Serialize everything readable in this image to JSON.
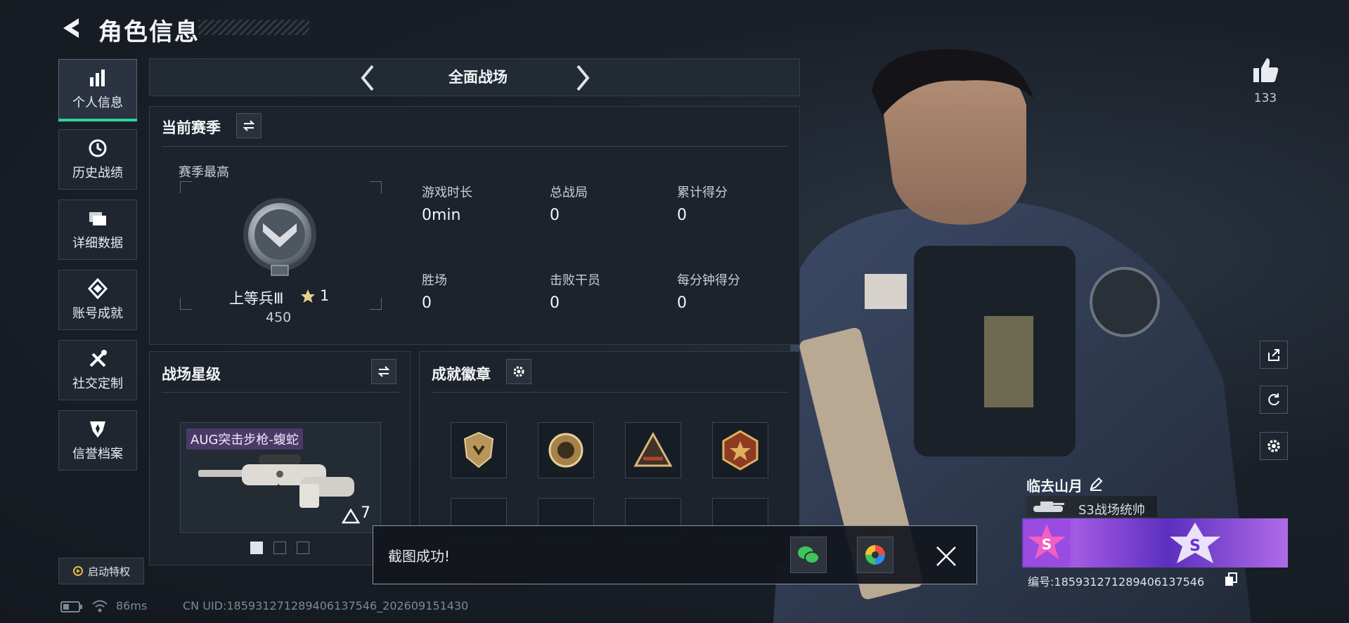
{
  "header": {
    "title": "角色信息"
  },
  "sidebar": {
    "items": [
      {
        "label": "个人信息",
        "icon": "bar-chart-icon"
      },
      {
        "label": "历史战绩",
        "icon": "history-icon"
      },
      {
        "label": "详细数据",
        "icon": "folder-icon"
      },
      {
        "label": "账号成就",
        "icon": "achievement-icon"
      },
      {
        "label": "社交定制",
        "icon": "tools-icon"
      },
      {
        "label": "信誉档案",
        "icon": "shield-icon"
      }
    ],
    "privilege_label": "启动特权"
  },
  "mode": {
    "label": "全面战场"
  },
  "season": {
    "title": "当前赛季",
    "best_label": "赛季最高",
    "rank_name": "上等兵Ⅲ",
    "rank_stars": "1",
    "rank_score": "450",
    "stats": [
      {
        "label": "游戏时长",
        "value": "0min"
      },
      {
        "label": "总战局",
        "value": "0"
      },
      {
        "label": "累计得分",
        "value": "0"
      },
      {
        "label": "胜场",
        "value": "0"
      },
      {
        "label": "击败干员",
        "value": "0"
      },
      {
        "label": "每分钟得分",
        "value": "0"
      }
    ]
  },
  "star_level": {
    "title": "战场星级",
    "weapon_name": "AUG突击步枪-蝮蛇",
    "weapon_level": "7"
  },
  "badges": {
    "title": "成就徽章"
  },
  "toast": {
    "message": "截图成功!"
  },
  "right": {
    "likes": "133"
  },
  "player": {
    "name": "临去山月",
    "title": "S3战场统帅",
    "id_label": "编号:1859312712894061375​46"
  },
  "status": {
    "ping": "86ms",
    "uid": "CN UID:1859312712894061375​46_202609151430"
  },
  "colors": {
    "accent": "#2fd39a",
    "purple": "#7b3fd6",
    "gold": "#c9a25a"
  }
}
